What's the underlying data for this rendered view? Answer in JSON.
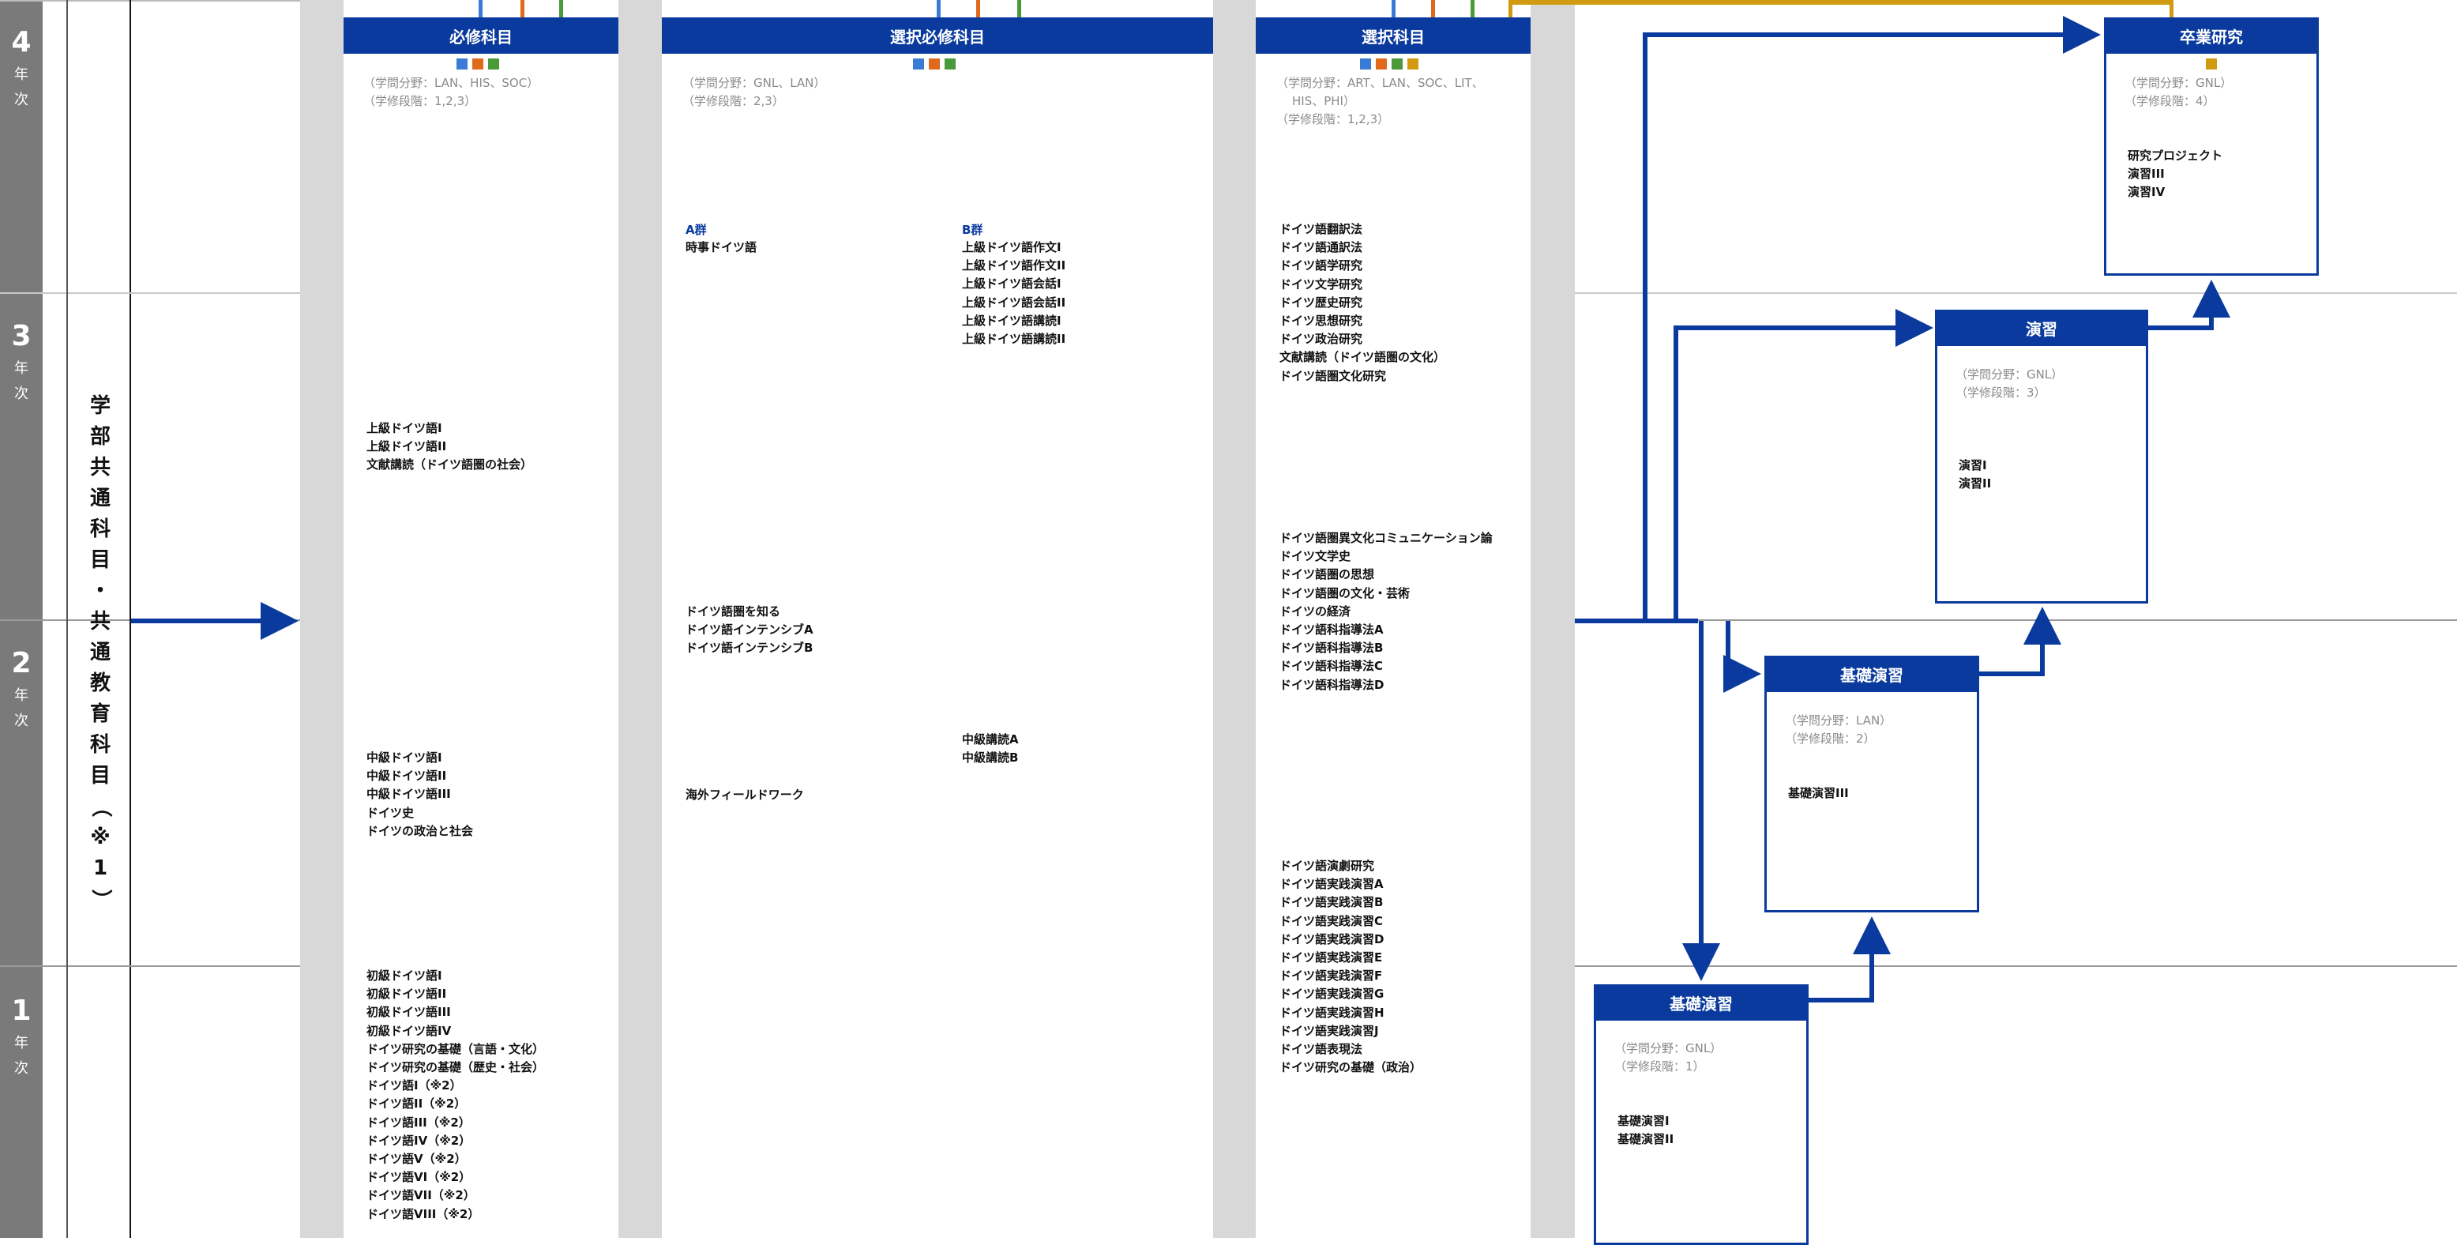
{
  "years": [
    {
      "num": "4",
      "label": [
        "年",
        "次"
      ]
    },
    {
      "num": "3",
      "label": [
        "年",
        "次"
      ]
    },
    {
      "num": "2",
      "label": [
        "年",
        "次"
      ]
    },
    {
      "num": "1",
      "label": [
        "年",
        "次"
      ]
    }
  ],
  "common_subjects": "学部共通科目・共通教育科目（※1）",
  "colors": {
    "blue": "#3a7bd5",
    "orange": "#e06a1b",
    "green": "#4a9a3a",
    "gold": "#d29a10",
    "navy": "#0a3a9e"
  },
  "required": {
    "title": "必修科目",
    "field": "（学問分野：LAN、HIS、SOC）",
    "stage": "（学修段階：1,2,3）",
    "year3": [
      "上級ドイツ語I",
      "上級ドイツ語II",
      "文献講読（ドイツ語圏の社会）"
    ],
    "year2": [
      "中級ドイツ語I",
      "中級ドイツ語II",
      "中級ドイツ語III",
      "ドイツ史",
      "ドイツの政治と社会"
    ],
    "year1": [
      "初級ドイツ語I",
      "初級ドイツ語II",
      "初級ドイツ語III",
      "初級ドイツ語IV",
      "ドイツ研究の基礎（言語・文化）",
      "ドイツ研究の基礎（歴史・社会）",
      "",
      "ドイツ語I（※2）",
      "ドイツ語II（※2）",
      "ドイツ語III（※2）",
      "ドイツ語IV（※2）",
      "ドイツ語V（※2）",
      "ドイツ語VI（※2）",
      "ドイツ語VII（※2）",
      "ドイツ語VIII（※2）"
    ]
  },
  "elective_required": {
    "title": "選択必修科目",
    "field": "（学問分野：GNL、LAN）",
    "stage": "（学修段階：2,3）",
    "group_a": "A群",
    "group_b": "B群",
    "a_year4": [
      "時事ドイツ語"
    ],
    "b_year4": [
      "上級ドイツ語作文I",
      "上級ドイツ語作文II",
      "上級ドイツ語会話I",
      "上級ドイツ語会話II",
      "上級ドイツ語講読I",
      "上級ドイツ語講読II"
    ],
    "a_year3": [
      "ドイツ語圏を知る",
      "ドイツ語インテンシブA",
      "ドイツ語インテンシブB"
    ],
    "b_year2": [
      "中級講読A",
      "中級講読B"
    ],
    "a_year2": [
      "海外フィールドワーク"
    ]
  },
  "elective": {
    "title": "選択科目",
    "field": "（学問分野：ART、LAN、SOC、LIT、",
    "field2": "HIS、PHI）",
    "stage": "（学修段階：1,2,3）",
    "year4": [
      "ドイツ語翻訳法",
      "ドイツ語通訳法",
      "ドイツ語学研究",
      "ドイツ文学研究",
      "ドイツ歴史研究",
      "ドイツ思想研究",
      "ドイツ政治研究",
      "文献講読（ドイツ語圏の文化）",
      "ドイツ語圏文化研究"
    ],
    "year3": [
      "ドイツ語圏異文化コミュニケーション論",
      "ドイツ文学史",
      "ドイツ語圏の思想",
      "ドイツ語圏の文化・芸術",
      "ドイツの経済",
      "ドイツ語科指導法A",
      "ドイツ語科指導法B",
      "ドイツ語科指導法C",
      "ドイツ語科指導法D"
    ],
    "year2": [
      "ドイツ語演劇研究",
      "ドイツ語実践演習A",
      "ドイツ語実践演習B",
      "ドイツ語実践演習C",
      "ドイツ語実践演習D",
      "ドイツ語実践演習E",
      "ドイツ語実践演習F",
      "ドイツ語実践演習G",
      "ドイツ語実践演習H",
      "ドイツ語実践演習J",
      "ドイツ語表現法",
      "ドイツ研究の基礎（政治）"
    ]
  },
  "thesis": {
    "title": "卒業研究",
    "field": "（学問分野：GNL）",
    "stage": "（学修段階：4）",
    "courses": [
      "研究プロジェクト",
      "演習III",
      "演習IV"
    ]
  },
  "seminar": {
    "title": "演習",
    "field": "（学問分野：GNL）",
    "stage": "（学修段階：3）",
    "courses": [
      "演習I",
      "演習II"
    ]
  },
  "basic_seminar2": {
    "title": "基礎演習",
    "field": "（学問分野：LAN）",
    "stage": "（学修段階：2）",
    "courses": [
      "基礎演習III"
    ]
  },
  "basic_seminar1": {
    "title": "基礎演習",
    "field": "（学問分野：GNL）",
    "stage": "（学修段階：1）",
    "courses": [
      "基礎演習I",
      "基礎演習II"
    ]
  }
}
